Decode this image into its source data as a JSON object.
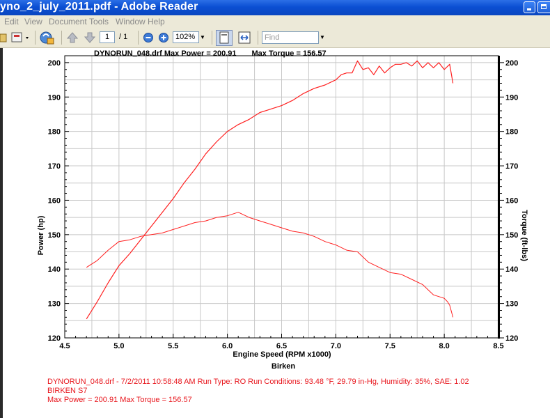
{
  "window": {
    "title": "yno_2_july_2011.pdf - Adobe Reader"
  },
  "menu": {
    "items": [
      "Edit",
      "View",
      "Document",
      "Tools",
      "Window",
      "Help"
    ]
  },
  "toolbar": {
    "page_number": "1",
    "page_total": "/ 1",
    "zoom": "102%",
    "find_placeholder": "Find"
  },
  "colors": {
    "titlebar": "#0b4fd3",
    "curve": "#ff2020",
    "info_text": "#e8141b"
  },
  "header": {
    "file_power": "DYNORUN_048.drf Max Power = 200.91",
    "torque": "Max Torque = 156.57"
  },
  "info": {
    "line1": "DYNORUN_048.drf - 7/2/2011 10:58:48 AM  Run Type: RO  Run Conditions: 93.48 °F, 29.79 in-Hg,  Humidity:  35%, SAE: 1.02",
    "line2": "BIRKEN S7",
    "line3": "Max Power = 200.91  Max Torque = 156.57"
  },
  "chart_data": {
    "type": "line",
    "title": "DYNORUN_048.drf Max Power = 200.91    Max Torque = 156.57",
    "xlabel": "Engine Speed (RPM x1000)",
    "xsublabel": "Birken",
    "ylabel": "Power (hp)",
    "y2label": "Torque (ft-lbs)",
    "xlim": [
      4.5,
      8.5
    ],
    "ylim": [
      120,
      202
    ],
    "y2lim": [
      120,
      202
    ],
    "xticks": [
      "4.5",
      "5.0",
      "5.5",
      "6.0",
      "6.5",
      "7.0",
      "7.5",
      "8.0",
      "8.5"
    ],
    "yticks": [
      "120",
      "130",
      "140",
      "150",
      "160",
      "170",
      "180",
      "190",
      "200"
    ],
    "grid": true,
    "series": [
      {
        "axis": "left",
        "x": [
          4.7,
          4.8,
          4.9,
          5.0,
          5.1,
          5.2,
          5.3,
          5.4,
          5.5,
          5.6,
          5.7,
          5.8,
          5.9,
          6.0,
          6.1,
          6.2,
          6.3,
          6.4,
          6.5,
          6.6,
          6.7,
          6.8,
          6.9,
          7.0,
          7.05,
          7.1,
          7.15,
          7.2,
          7.25,
          7.3,
          7.35,
          7.4,
          7.45,
          7.5,
          7.55,
          7.6,
          7.65,
          7.7,
          7.75,
          7.8,
          7.85,
          7.9,
          7.95,
          8.0,
          8.05,
          8.08
        ],
        "values": [
          125.5,
          130.5,
          136.0,
          141.0,
          144.5,
          148.5,
          152.5,
          156.5,
          160.5,
          165.0,
          169.0,
          173.5,
          177.0,
          180.0,
          182.0,
          183.5,
          185.5,
          186.5,
          187.5,
          189.0,
          191.0,
          192.5,
          193.5,
          195.0,
          196.5,
          197.0,
          197.0,
          200.5,
          198.0,
          198.5,
          196.5,
          199.0,
          197.0,
          198.5,
          199.5,
          199.5,
          200.0,
          199.0,
          200.5,
          198.5,
          200.0,
          198.5,
          200.0,
          198.0,
          199.5,
          194.0
        ]
      },
      {
        "axis": "right",
        "x": [
          4.7,
          4.8,
          4.9,
          5.0,
          5.1,
          5.2,
          5.3,
          5.4,
          5.5,
          5.6,
          5.7,
          5.8,
          5.9,
          6.0,
          6.1,
          6.2,
          6.3,
          6.4,
          6.5,
          6.6,
          6.7,
          6.8,
          6.9,
          7.0,
          7.1,
          7.2,
          7.3,
          7.4,
          7.5,
          7.6,
          7.7,
          7.8,
          7.85,
          7.9,
          7.95,
          8.0,
          8.03,
          8.05,
          8.08
        ],
        "values": [
          140.5,
          142.5,
          145.5,
          148.0,
          148.5,
          149.5,
          150.0,
          150.5,
          151.5,
          152.5,
          153.5,
          154.0,
          155.0,
          155.5,
          156.5,
          155.0,
          154.0,
          153.0,
          152.0,
          151.0,
          150.5,
          149.5,
          148.0,
          147.0,
          145.5,
          145.0,
          142.0,
          140.5,
          139.0,
          138.5,
          137.0,
          135.5,
          134.0,
          132.5,
          132.0,
          131.5,
          130.5,
          129.5,
          126.0
        ]
      }
    ]
  }
}
